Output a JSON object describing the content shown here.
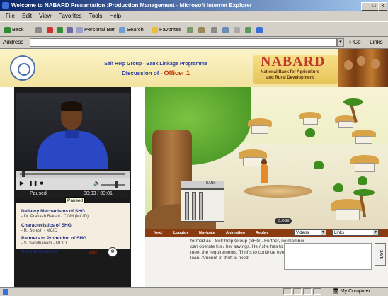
{
  "window": {
    "title": "Welcome to NABARD Presentation :Production Management - Microsoft Internet Explorer",
    "controls": [
      "_",
      "□",
      "x"
    ]
  },
  "menu": [
    "File",
    "Edit",
    "View",
    "Favorites",
    "Tools",
    "Help"
  ],
  "toolbar": {
    "back": "Back",
    "personal_bar": "Personal Bar",
    "search": "Search",
    "favorites": "Favorites"
  },
  "addressbar": {
    "label": "Address",
    "value": "",
    "go": "Go",
    "links": "Links"
  },
  "header": {
    "line1": "Self Help Group - Bank Linkage Programme",
    "line2_prefix": "Discussion of - ",
    "line2_officer": "Officer 1",
    "brand": "NABARD",
    "brand_sub1": "National Bank for Agriculture",
    "brand_sub2": "and Rural Development"
  },
  "player": {
    "state": "Paused",
    "time": "00:03 / 03:01",
    "tooltip": "Paused",
    "progress": 0.02,
    "volume": 0.7
  },
  "topics": [
    {
      "title": "Delivery Mechanisms of SHG",
      "sub": "- Dr. Prakash Bakshi - CGM (MCID)"
    },
    {
      "title": "Characteristics of SHG",
      "sub": "- R. Suresh - MCID"
    },
    {
      "title": "Partners in Promotion of SHG",
      "sub": "- S. Sandhanam - MCID"
    },
    {
      "title": "Reallife Example",
      "sub": ""
    }
  ],
  "scroll_label": "scroll",
  "scene": {
    "bank_sign": "BANK",
    "close": "CLOSE"
  },
  "navbar": {
    "items": [
      "Next",
      "Loguide",
      "Navigate",
      "Animation",
      "Replay"
    ],
    "select_video": "Videos",
    "select_links": "Links"
  },
  "explain_text": "formed as - Self-help Group (SHG). Further, no member can operate his / her savings. He / she has to take loans to meet the requirements. Thrifts to continue even after taking loan. Amount of thrift is fixed",
  "save_label": "SAVE",
  "statusbar": {
    "zone": "My Computer"
  }
}
